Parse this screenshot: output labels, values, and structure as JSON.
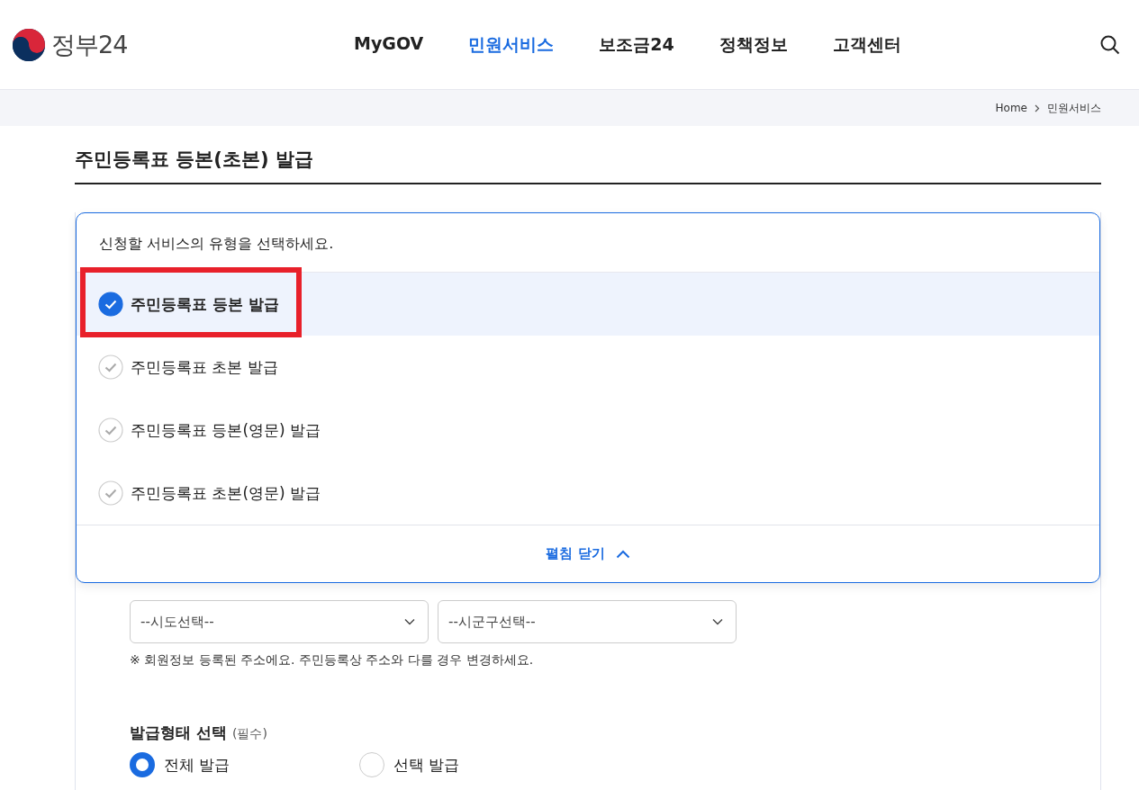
{
  "header": {
    "logo_text": "정부24",
    "nav": [
      {
        "label": "MyGOV",
        "selected": false
      },
      {
        "label": "민원서비스",
        "selected": true
      },
      {
        "label": "보조금24",
        "selected": false
      },
      {
        "label": "정책정보",
        "selected": false
      },
      {
        "label": "고객센터",
        "selected": false
      }
    ]
  },
  "breadcrumb": [
    "Home",
    "민원서비스"
  ],
  "page_title": "주민등록표 등본(초본) 발급",
  "service_panel": {
    "prompt": "신청할 서비스의 유형을 선택하세요.",
    "options": [
      {
        "label": "주민등록표 등본 발급",
        "selected": true,
        "highlighted": true
      },
      {
        "label": "주민등록표 초본 발급",
        "selected": false,
        "highlighted": false
      },
      {
        "label": "주민등록표 등본(영문) 발급",
        "selected": false,
        "highlighted": false
      },
      {
        "label": "주민등록표 초본(영문) 발급",
        "selected": false,
        "highlighted": false
      }
    ],
    "collapse_label": "펼침 닫기"
  },
  "address": {
    "selects": [
      {
        "placeholder": "--시도선택--"
      },
      {
        "placeholder": "--시군구선택--"
      }
    ],
    "note": "※ 회원정보 등록된 주소에요. 주민등록상 주소와 다를 경우 변경하세요."
  },
  "issue_type": {
    "title": "발급형태 선택",
    "required": "(필수)",
    "options": [
      {
        "label": "전체 발급",
        "selected": true
      },
      {
        "label": "선택 발급",
        "selected": false
      }
    ]
  }
}
